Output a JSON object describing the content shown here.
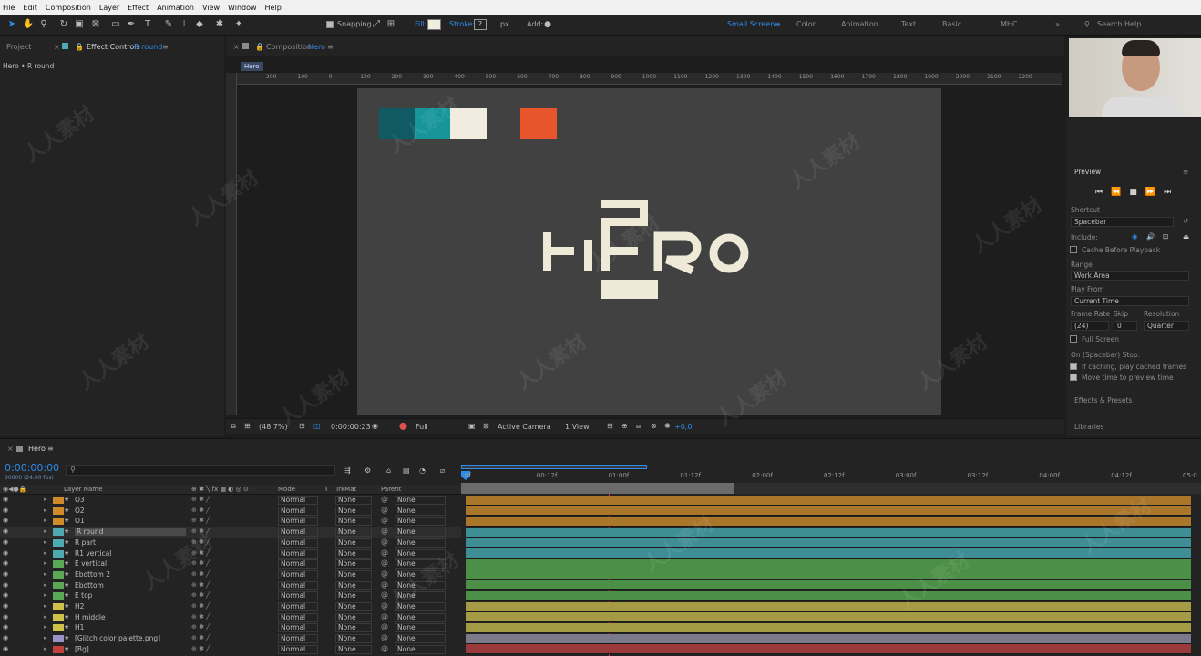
{
  "menu": [
    "File",
    "Edit",
    "Composition",
    "Layer",
    "Effect",
    "Animation",
    "View",
    "Window",
    "Help"
  ],
  "toolbar": {
    "snapping": "Snapping",
    "fill": "Fill:",
    "stroke": "Stroke:",
    "stroke_px": "px",
    "add": "Add:",
    "workspaces": [
      "Small Screen",
      "Color",
      "Animation",
      "Text",
      "Basic",
      "MHC"
    ],
    "search": "Search Help"
  },
  "left": {
    "tab_project": "Project",
    "tab_effect": "Effect Controls",
    "tab_effect_layer": "R round",
    "breadcrumb": "Hero • R round"
  },
  "comp": {
    "tab_prefix": "Composition",
    "tab_name": "Hero",
    "flow_tag": "Hero",
    "ruler_ticks": [
      "200",
      "100",
      "0",
      "100",
      "200",
      "300",
      "400",
      "500",
      "600",
      "700",
      "800",
      "900",
      "1000",
      "1100",
      "1200",
      "1300",
      "1400",
      "1500",
      "1600",
      "1700",
      "1800",
      "1900",
      "2000",
      "2100",
      "2200"
    ],
    "logo_parts": [
      "H",
      "E",
      "R",
      "O"
    ],
    "swatches": [
      "#0f5a63",
      "#17969a",
      "#f0ece0",
      "#e8542c"
    ],
    "viewer": {
      "zoom": "(48,7%)",
      "time": "0:00:00:23",
      "quality": "Full",
      "camera": "Active Camera",
      "views": "1 View",
      "exposure": "+0,0"
    }
  },
  "preview": {
    "title": "Preview",
    "shortcut_label": "Shortcut",
    "shortcut": "Spacebar",
    "include": "Include:",
    "cache": "Cache Before Playback",
    "range_label": "Range",
    "range": "Work Area",
    "playfrom_label": "Play From",
    "playfrom": "Current Time",
    "framerate_label": "Frame Rate",
    "skip_label": "Skip",
    "resolution_label": "Resolution",
    "framerate": "(24)",
    "skip": "0",
    "resolution": "Quarter",
    "fullscreen": "Full Screen",
    "stop_label": "On (Spacebar) Stop:",
    "stop1": "If caching, play cached frames",
    "stop2": "Move time to preview time",
    "effects": "Effects & Presets",
    "libraries": "Libraries"
  },
  "timeline": {
    "tab": "Hero",
    "timecode": "0:00:00:00",
    "fps": "00000 (24.00 fps)",
    "search_placeholder": "",
    "col_layer": "Layer Name",
    "col_mode": "Mode",
    "col_t": "T",
    "col_trkmat": "TrkMat",
    "col_parent": "Parent",
    "ticks": [
      "0f",
      "00:12f",
      "01:00f",
      "01:12f",
      "02:00f",
      "02:12f",
      "03:00f",
      "03:12f",
      "04:00f",
      "04:12f",
      "05:0"
    ],
    "layers": [
      {
        "name": "O3",
        "color": "#d08a2a",
        "mode": "Normal",
        "trk": "None",
        "parent": "None",
        "bar": "#a9762a"
      },
      {
        "name": "O2",
        "color": "#d08a2a",
        "mode": "Normal",
        "trk": "None",
        "parent": "None",
        "bar": "#a9762a"
      },
      {
        "name": "O1",
        "color": "#d08a2a",
        "mode": "Normal",
        "trk": "None",
        "parent": "None",
        "bar": "#a9762a"
      },
      {
        "name": "R round",
        "color": "#4fa9b0",
        "mode": "Normal",
        "trk": "None",
        "parent": "None",
        "bar": "#3f8e96"
      },
      {
        "name": "R part",
        "color": "#4fa9b0",
        "mode": "Normal",
        "trk": "None",
        "parent": "None",
        "bar": "#3f8e96"
      },
      {
        "name": "R1 vertical",
        "color": "#4fa9b0",
        "mode": "Normal",
        "trk": "None",
        "parent": "None",
        "bar": "#3f8e96"
      },
      {
        "name": "E vertical",
        "color": "#5aa855",
        "mode": "Normal",
        "trk": "None",
        "parent": "None",
        "bar": "#4c8f47"
      },
      {
        "name": "Ebottom 2",
        "color": "#5aa855",
        "mode": "Normal",
        "trk": "None",
        "parent": "None",
        "bar": "#4c8f47"
      },
      {
        "name": "Ebottom",
        "color": "#5aa855",
        "mode": "Normal",
        "trk": "None",
        "parent": "None",
        "bar": "#4c8f47"
      },
      {
        "name": "E top",
        "color": "#5aa855",
        "mode": "Normal",
        "trk": "None",
        "parent": "None",
        "bar": "#4c8f47"
      },
      {
        "name": "H2",
        "color": "#cfc04a",
        "mode": "Normal",
        "trk": "None",
        "parent": "None",
        "bar": "#a59b45"
      },
      {
        "name": "H middle",
        "color": "#cfc04a",
        "mode": "Normal",
        "trk": "None",
        "parent": "None",
        "bar": "#a59b45"
      },
      {
        "name": "H1",
        "color": "#cfc04a",
        "mode": "Normal",
        "trk": "None",
        "parent": "None",
        "bar": "#a59b45"
      },
      {
        "name": "[Glitch color palette.png]",
        "color": "#9a93c9",
        "mode": "Normal",
        "trk": "None",
        "parent": "None",
        "bar": "#7a7a8a"
      },
      {
        "name": "[Bg]",
        "color": "#c04040",
        "mode": "Normal",
        "trk": "None",
        "parent": "None",
        "bar": "#9a3a3a"
      }
    ]
  },
  "watermark": "人人素材"
}
